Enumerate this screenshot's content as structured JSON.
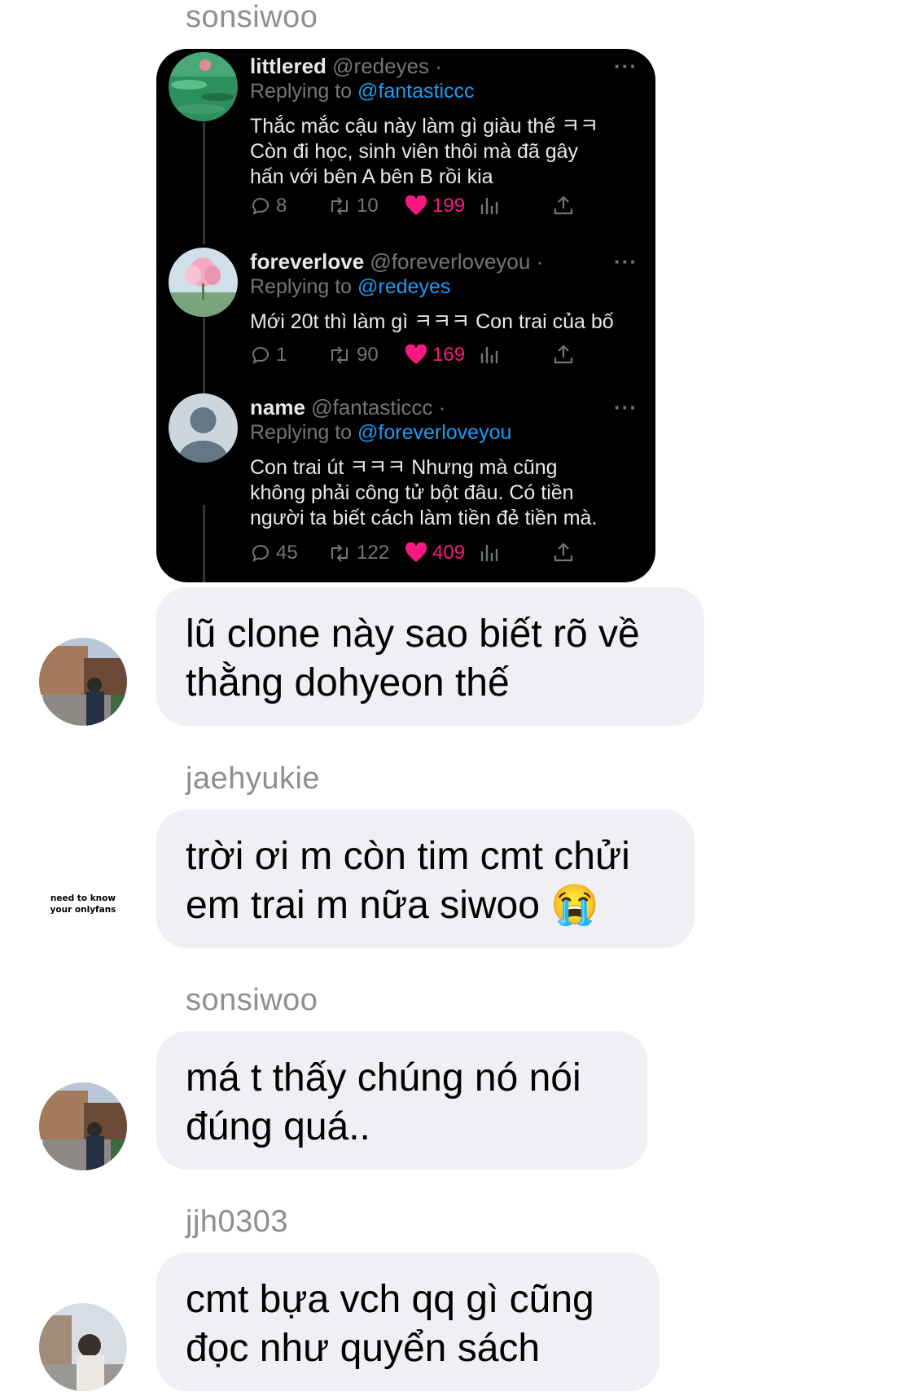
{
  "colors": {
    "bubble": "#efeff4",
    "tweet_bg": "#000000",
    "mention": "#1d9bf0",
    "like": "#f91880",
    "muted": "#71767b"
  },
  "top_sender": "sonsiwoo",
  "tweets": [
    {
      "name": "littlered",
      "handle": "@redeyes ·",
      "more": "···",
      "replying_prefix": "Replying to",
      "replying_to": "@fantasticcc",
      "lines": [
        "Thắc mắc cậu này làm gì giàu thế ㅋㅋ",
        "Còn đi học, sinh viên thôi mà đã gây",
        "hấn với bên A bên B rồi kia"
      ],
      "replies": "8",
      "retweets": "10",
      "likes": "199",
      "icons": [
        "reply-icon",
        "retweet-icon",
        "heart-icon",
        "views-icon",
        "share-icon"
      ]
    },
    {
      "name": "foreverlove",
      "handle": "@foreverloveyou ·",
      "more": "···",
      "replying_prefix": "Replying to",
      "replying_to": "@redeyes",
      "lines": [
        "Mới 20t thì làm gì ㅋㅋㅋ Con trai của bố"
      ],
      "replies": "1",
      "retweets": "90",
      "likes": "169"
    },
    {
      "name": "name",
      "handle": "@fantasticcc ·",
      "more": "···",
      "replying_prefix": "Replying to",
      "replying_to": "@foreverloveyou",
      "lines": [
        "Con trai út ㅋㅋㅋ Nhưng mà cũng",
        "không phải công tử bột đâu. Có tiền",
        "người ta biết cách làm tiền đẻ tiền mà."
      ],
      "replies": "45",
      "retweets": "122",
      "likes": "409"
    }
  ],
  "messages": [
    {
      "sender": "",
      "lines": [
        "lũ clone này sao biết rõ về",
        "thằng dohyeon thế"
      ]
    },
    {
      "sender": "jaehyukie",
      "lines": [
        "trời ơi m còn tim cmt chửi",
        "em trai m nữa siwoo 😭"
      ],
      "avatar_text": [
        "need to know",
        "your onlyfans"
      ]
    },
    {
      "sender": "sonsiwoo",
      "lines": [
        "má t thấy chúng nó nói",
        "đúng quá.."
      ]
    },
    {
      "sender": "jjh0303",
      "lines": [
        "cmt bựa vch qq gì cũng",
        "đọc như quyển sách"
      ]
    }
  ]
}
